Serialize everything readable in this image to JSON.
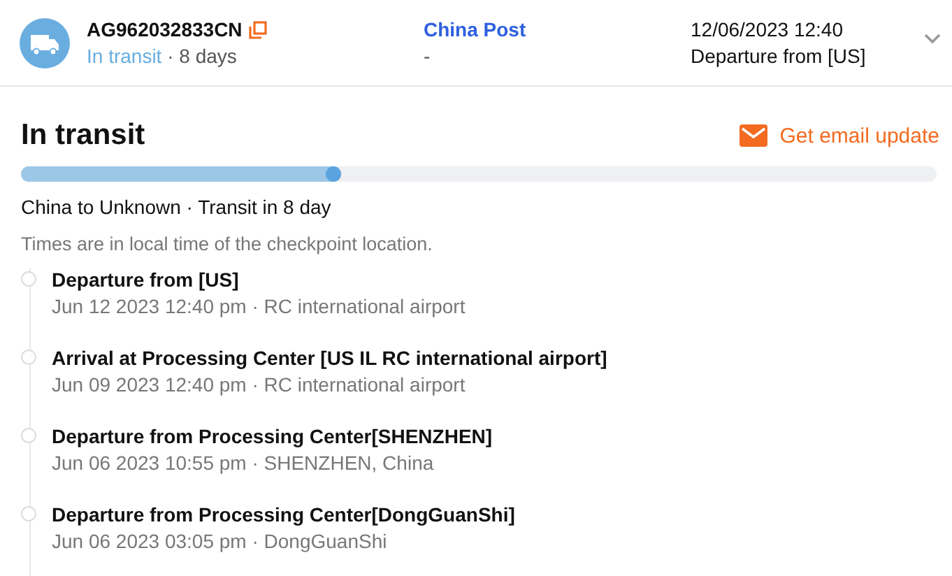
{
  "shipment": {
    "tracking_number": "AG962032833CN",
    "status": "In transit",
    "duration": "· 8 days",
    "carrier": "China Post",
    "carrier_sub": "-",
    "latest_time": "12/06/2023 12:40",
    "latest_event": "Departure from [US]"
  },
  "summary": {
    "title": "In transit",
    "email_button": "Get email update",
    "progress": {
      "level": 0.35
    },
    "route": "China to Unknown · Transit in 8 day",
    "note": "Times are in local time of the checkpoint location."
  },
  "events": [
    {
      "title": "Departure from [US]",
      "detail": "Jun 12 2023 12:40 pm · RC international airport"
    },
    {
      "title": "Arrival at Processing Center [US IL RC international airport]",
      "detail": "Jun 09 2023 12:40 pm · RC international airport"
    },
    {
      "title": "Departure from Processing Center[SHENZHEN]",
      "detail": "Jun 06 2023 10:55 pm · SHENZHEN, China"
    },
    {
      "title": "Departure from Processing Center[DongGuanShi]",
      "detail": "Jun 06 2023 03:05 pm · DongGuanShi"
    }
  ]
}
